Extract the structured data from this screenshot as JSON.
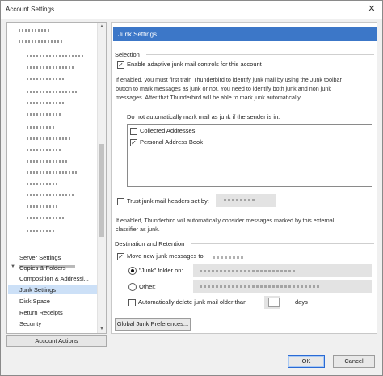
{
  "window": {
    "title": "Account Settings",
    "close_glyph": "✕"
  },
  "tree": {
    "items": [
      {
        "label": "Server Settings"
      },
      {
        "label": "Copies & Folders"
      },
      {
        "label": "Composition & Addressi..."
      },
      {
        "label": "Junk Settings",
        "selected": true
      },
      {
        "label": "Disk Space"
      },
      {
        "label": "Return Receipts"
      },
      {
        "label": "Security"
      }
    ],
    "account_actions_label": "Account Actions"
  },
  "panel": {
    "header": "Junk Settings",
    "selection_label": "Selection",
    "enable_adaptive_label": "Enable adaptive junk mail controls for this account",
    "enable_adaptive_checked": true,
    "desc1_line1": "If enabled, you must first train Thunderbird to identify junk mail by using the Junk toolbar",
    "desc1_line2": "button to mark messages as junk or not. You need to identify both junk and non junk",
    "desc1_line3": "messages. After that Thunderbird will be able to mark junk automatically.",
    "do_not_mark_label": "Do not automatically mark mail as junk if the sender is in:",
    "address_books": [
      {
        "label": "Collected Addresses",
        "checked": false
      },
      {
        "label": "Personal Address Book",
        "checked": true
      }
    ],
    "trust_headers_label": "Trust junk mail headers set by:",
    "trust_headers_checked": false,
    "desc2_line1": "If enabled, Thunderbird will automatically consider messages marked by this external",
    "desc2_line2": "classifier as junk.",
    "dest_label": "Destination and Retention",
    "move_new_label": "Move new junk messages to:",
    "move_new_checked": true,
    "junk_folder_label": "\"Junk\" folder on:",
    "junk_folder_selected": true,
    "other_label": "Other:",
    "other_selected": false,
    "auto_delete_label": "Automatically delete junk mail older than",
    "auto_delete_checked": false,
    "days_label": "days",
    "global_prefs_label": "Global Junk Preferences..."
  },
  "footer": {
    "ok_label": "OK",
    "cancel_label": "Cancel"
  }
}
